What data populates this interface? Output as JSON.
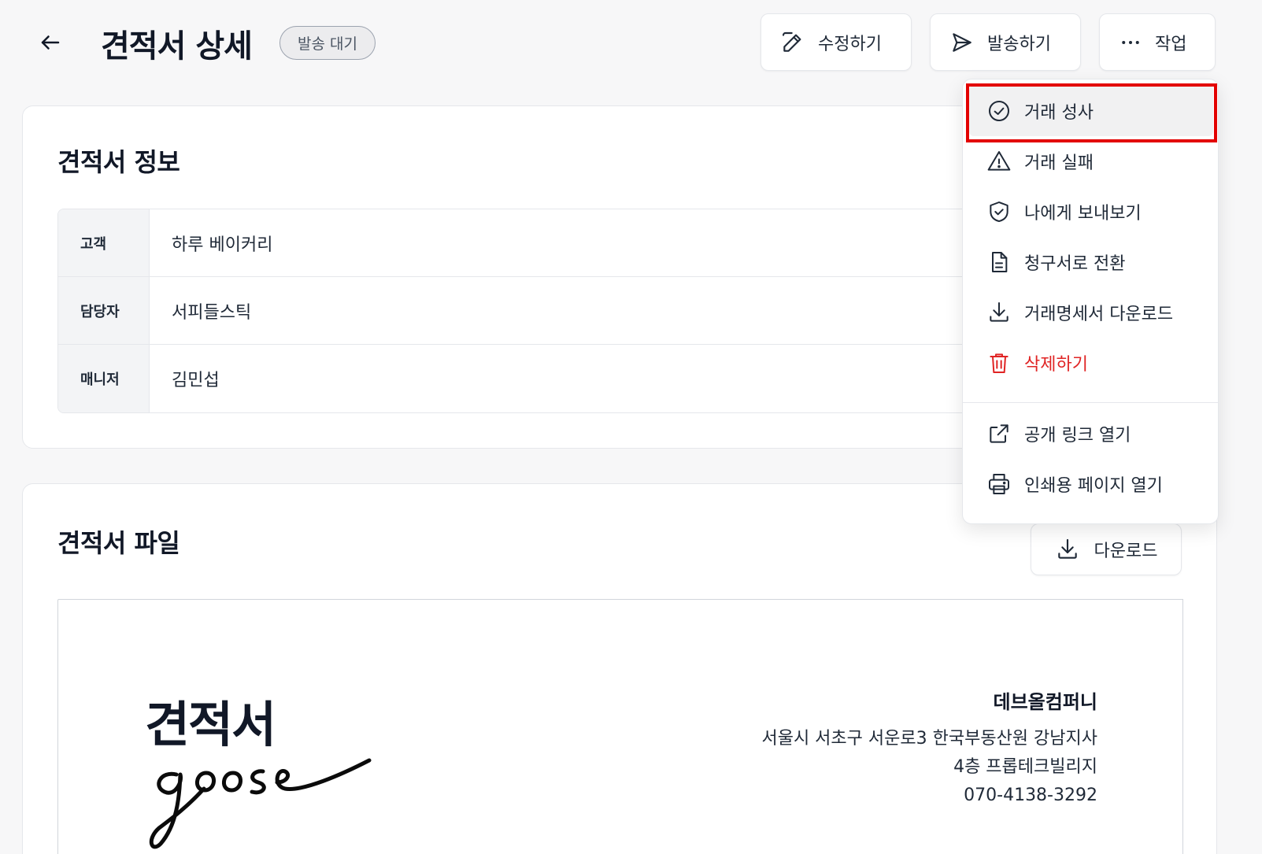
{
  "header": {
    "title": "견적서 상세",
    "status_badge": "발송 대기",
    "edit_label": "수정하기",
    "send_label": "발송하기",
    "actions_label": "작업"
  },
  "info_card": {
    "title": "견적서 정보",
    "rows": [
      {
        "label": "고객",
        "value": "하루 베이커리"
      },
      {
        "label": "담당자",
        "value": "서피들스틱"
      },
      {
        "label": "매니저",
        "value": "김민섭"
      }
    ]
  },
  "file_card": {
    "title": "견적서 파일",
    "download_label": "다운로드",
    "document": {
      "heading": "견적서",
      "logo_text": "goose",
      "company_name": "데브올컴퍼니",
      "address_line1": "서울시 서초구 서운로3 한국부동산원 강남지사",
      "address_line2": "4층 프롭테크빌리지",
      "phone": "070-4138-3292"
    }
  },
  "action_menu": {
    "items": [
      {
        "label": "거래 성사",
        "icon": "check-circle-icon"
      },
      {
        "label": "거래 실패",
        "icon": "warning-triangle-icon"
      },
      {
        "label": "나에게 보내보기",
        "icon": "shield-check-icon"
      },
      {
        "label": "청구서로 전환",
        "icon": "document-icon"
      },
      {
        "label": "거래명세서 다운로드",
        "icon": "download-icon"
      },
      {
        "label": "삭제하기",
        "icon": "trash-icon"
      },
      {
        "label": "공개 링크 열기",
        "icon": "external-link-icon"
      },
      {
        "label": "인쇄용 페이지 열기",
        "icon": "printer-icon"
      }
    ]
  },
  "colors": {
    "danger": "#e02424",
    "highlight": "#e30000",
    "background": "#f7f7f8"
  }
}
